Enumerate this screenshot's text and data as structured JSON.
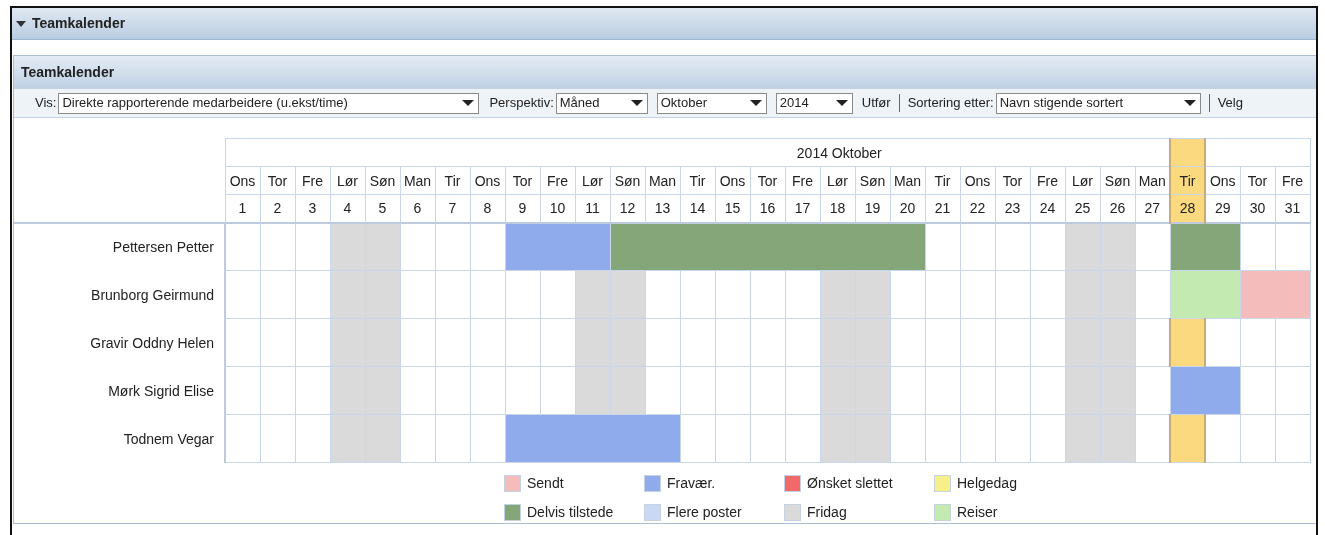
{
  "panel": {
    "title": "Teamkalender",
    "expanded": true
  },
  "calendar_panel": {
    "title": "Teamkalender"
  },
  "toolbar": {
    "view_label": "Vis:",
    "view_value": "Direkte rapporterende medarbeidere (u.ekst/time)",
    "perspective_label": "Perspektiv:",
    "perspective_value": "Måned",
    "month_value": "Oktober",
    "year_value": "2014",
    "run_link": "Utfør",
    "sort_label": "Sortering etter:",
    "sort_value": "Navn stigende sortert",
    "choose_label": "Velg"
  },
  "calendar": {
    "month_title": "2014 Oktober",
    "days": [
      {
        "weekday": "Ons",
        "day": "1",
        "selected": false
      },
      {
        "weekday": "Tor",
        "day": "2",
        "selected": false
      },
      {
        "weekday": "Fre",
        "day": "3",
        "selected": false
      },
      {
        "weekday": "Lør",
        "day": "4",
        "selected": false
      },
      {
        "weekday": "Søn",
        "day": "5",
        "selected": false
      },
      {
        "weekday": "Man",
        "day": "6",
        "selected": false
      },
      {
        "weekday": "Tir",
        "day": "7",
        "selected": false
      },
      {
        "weekday": "Ons",
        "day": "8",
        "selected": false
      },
      {
        "weekday": "Tor",
        "day": "9",
        "selected": false
      },
      {
        "weekday": "Fre",
        "day": "10",
        "selected": false
      },
      {
        "weekday": "Lør",
        "day": "11",
        "selected": false
      },
      {
        "weekday": "Søn",
        "day": "12",
        "selected": false
      },
      {
        "weekday": "Man",
        "day": "13",
        "selected": false
      },
      {
        "weekday": "Tir",
        "day": "14",
        "selected": false
      },
      {
        "weekday": "Ons",
        "day": "15",
        "selected": false
      },
      {
        "weekday": "Tor",
        "day": "16",
        "selected": false
      },
      {
        "weekday": "Fre",
        "day": "17",
        "selected": false
      },
      {
        "weekday": "Lør",
        "day": "18",
        "selected": false
      },
      {
        "weekday": "Søn",
        "day": "19",
        "selected": false
      },
      {
        "weekday": "Man",
        "day": "20",
        "selected": false
      },
      {
        "weekday": "Tir",
        "day": "21",
        "selected": false
      },
      {
        "weekday": "Ons",
        "day": "22",
        "selected": false
      },
      {
        "weekday": "Tor",
        "day": "23",
        "selected": false
      },
      {
        "weekday": "Fre",
        "day": "24",
        "selected": false
      },
      {
        "weekday": "Lør",
        "day": "25",
        "selected": false
      },
      {
        "weekday": "Søn",
        "day": "26",
        "selected": false
      },
      {
        "weekday": "Man",
        "day": "27",
        "selected": false
      },
      {
        "weekday": "Tir",
        "day": "28",
        "selected": true
      },
      {
        "weekday": "Ons",
        "day": "29",
        "selected": false
      },
      {
        "weekday": "Tor",
        "day": "30",
        "selected": false
      },
      {
        "weekday": "Fre",
        "day": "31",
        "selected": false
      }
    ],
    "rows": [
      {
        "name": "Pettersen Petter",
        "cells": [
          null,
          null,
          null,
          {
            "kind": "off",
            "color": "#dadada"
          },
          {
            "kind": "off",
            "color": "#dadada"
          },
          null,
          null,
          null,
          {
            "kind": "bar",
            "color": "#8fabeb"
          },
          {
            "kind": "bar",
            "color": "#8fabeb"
          },
          {
            "kind": "bar",
            "color": "#8fabeb"
          },
          {
            "kind": "bar",
            "color": "#84a678"
          },
          {
            "kind": "bar",
            "color": "#84a678"
          },
          {
            "kind": "bar",
            "color": "#84a678"
          },
          {
            "kind": "bar",
            "color": "#84a678"
          },
          {
            "kind": "bar",
            "color": "#84a678"
          },
          {
            "kind": "bar",
            "color": "#84a678"
          },
          {
            "kind": "bar",
            "color": "#84a678"
          },
          {
            "kind": "bar",
            "color": "#84a678"
          },
          {
            "kind": "bar",
            "color": "#84a678"
          },
          null,
          null,
          null,
          null,
          {
            "kind": "off",
            "color": "#dadada"
          },
          {
            "kind": "off",
            "color": "#dadada"
          },
          null,
          {
            "kind": "bar",
            "color": "#84a678"
          },
          {
            "kind": "bar",
            "color": "#84a678"
          },
          null,
          null
        ]
      },
      {
        "name": "Brunborg Geirmund",
        "cells": [
          null,
          null,
          null,
          {
            "kind": "off",
            "color": "#dadada"
          },
          {
            "kind": "off",
            "color": "#dadada"
          },
          null,
          null,
          null,
          null,
          null,
          {
            "kind": "off",
            "color": "#dadada"
          },
          {
            "kind": "off",
            "color": "#dadada"
          },
          null,
          null,
          null,
          null,
          null,
          {
            "kind": "off",
            "color": "#dadada"
          },
          {
            "kind": "off",
            "color": "#dadada"
          },
          null,
          null,
          null,
          null,
          null,
          {
            "kind": "off",
            "color": "#dadada"
          },
          {
            "kind": "off",
            "color": "#dadada"
          },
          null,
          {
            "kind": "bar",
            "color": "#c3eab0"
          },
          {
            "kind": "bar",
            "color": "#c3eab0"
          },
          {
            "kind": "bar",
            "color": "#f5bcbc"
          },
          {
            "kind": "bar",
            "color": "#f5bcbc"
          }
        ]
      },
      {
        "name": "Gravir Oddny Helen",
        "cells": [
          null,
          null,
          null,
          {
            "kind": "off",
            "color": "#dadada"
          },
          {
            "kind": "off",
            "color": "#dadada"
          },
          null,
          null,
          null,
          null,
          null,
          {
            "kind": "off",
            "color": "#dadada"
          },
          {
            "kind": "off",
            "color": "#dadada"
          },
          null,
          null,
          null,
          null,
          null,
          {
            "kind": "off",
            "color": "#dadada"
          },
          {
            "kind": "off",
            "color": "#dadada"
          },
          null,
          null,
          null,
          null,
          null,
          {
            "kind": "off",
            "color": "#dadada"
          },
          {
            "kind": "off",
            "color": "#dadada"
          },
          null,
          null,
          null,
          null,
          null
        ]
      },
      {
        "name": "Mørk Sigrid Elise",
        "cells": [
          null,
          null,
          null,
          {
            "kind": "off",
            "color": "#dadada"
          },
          {
            "kind": "off",
            "color": "#dadada"
          },
          null,
          null,
          null,
          null,
          null,
          {
            "kind": "off",
            "color": "#dadada"
          },
          {
            "kind": "off",
            "color": "#dadada"
          },
          null,
          null,
          null,
          null,
          null,
          {
            "kind": "off",
            "color": "#dadada"
          },
          {
            "kind": "off",
            "color": "#dadada"
          },
          null,
          null,
          null,
          null,
          null,
          {
            "kind": "off",
            "color": "#dadada"
          },
          {
            "kind": "off",
            "color": "#dadada"
          },
          null,
          {
            "kind": "bar",
            "color": "#8fabeb"
          },
          {
            "kind": "bar",
            "color": "#8fabeb"
          },
          null,
          null
        ]
      },
      {
        "name": "Todnem Vegar",
        "cells": [
          null,
          null,
          null,
          {
            "kind": "off",
            "color": "#dadada"
          },
          {
            "kind": "off",
            "color": "#dadada"
          },
          null,
          null,
          null,
          {
            "kind": "bar",
            "color": "#8fabeb"
          },
          {
            "kind": "bar",
            "color": "#8fabeb"
          },
          {
            "kind": "bar",
            "color": "#8fabeb"
          },
          {
            "kind": "bar",
            "color": "#8fabeb"
          },
          {
            "kind": "bar",
            "color": "#8fabeb"
          },
          null,
          null,
          null,
          null,
          {
            "kind": "off",
            "color": "#dadada"
          },
          {
            "kind": "off",
            "color": "#dadada"
          },
          null,
          null,
          null,
          null,
          null,
          {
            "kind": "off",
            "color": "#dadada"
          },
          {
            "kind": "off",
            "color": "#dadada"
          },
          null,
          null,
          null,
          null,
          null
        ]
      }
    ]
  },
  "legend": [
    {
      "label": "Sendt",
      "color": "#f5bcbc"
    },
    {
      "label": "Fravær.",
      "color": "#8fabeb"
    },
    {
      "label": "Ønsket slettet",
      "color": "#f06a6a"
    },
    {
      "label": "Helgedag",
      "color": "#f7f08a"
    },
    {
      "label": "Delvis tilstede",
      "color": "#84a678"
    },
    {
      "label": "Flere poster",
      "color": "#cad8f5"
    },
    {
      "label": "Fridag",
      "color": "#dadada"
    },
    {
      "label": "Reiser",
      "color": "#c3eab0"
    }
  ]
}
